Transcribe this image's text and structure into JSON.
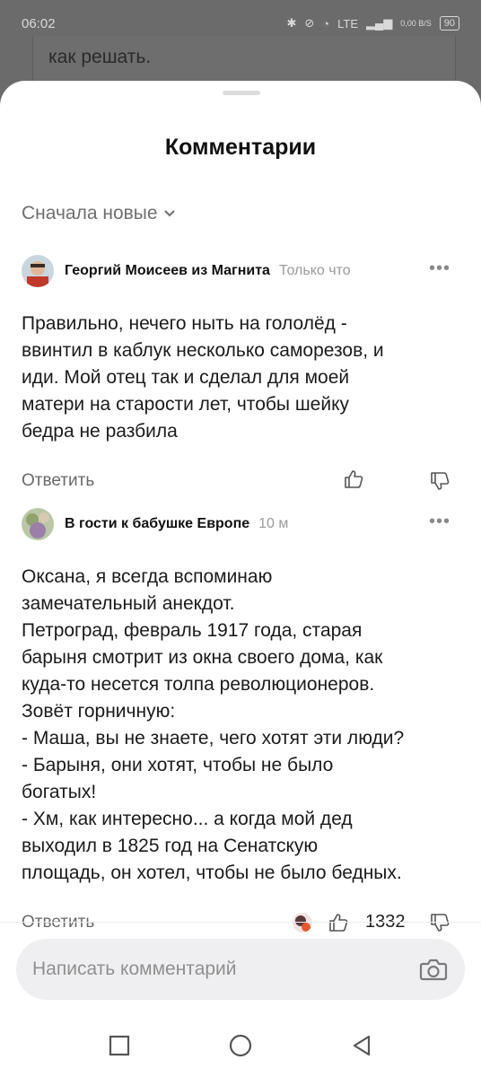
{
  "status_bar": {
    "time": "06:02",
    "network": "LTE",
    "speed": "0,00 B/S",
    "battery": "90"
  },
  "background": {
    "text": "как решать."
  },
  "sheet": {
    "title": "Комментарии",
    "sort_label": "Сначала новые"
  },
  "comments": [
    {
      "author": "Георгий Моисеев из Магнита",
      "time": "Только что",
      "text": "Правильно, нечего ныть на гололёд -\nввинтил в каблук несколько саморезов, и\nиди. Мой отец так и сделал для моей\nматери на старости лет, чтобы шейку\nбедра не разбила",
      "reply_label": "Ответить"
    },
    {
      "author": "В гости к бабушке Европе",
      "time": "10 м",
      "text": "Оксана, я всегда вспоминаю\nзамечательный анекдот.\nПетроград, февраль 1917 года, старая\nбарыня смотрит из окна своего дома, как\nкуда-то несется толпа революционеров.\nЗовёт горничную:\n- Маша, вы не знаете, чего хотят эти люди?\n- Барыня, они хотят, чтобы не было\nбогатых!\n- Хм, как интересно... а когда мой дед\nвыходил в 1825 год на Сенатскую\nплощадь, он хотел, чтобы не было бедных.",
      "reply_label": "Ответить",
      "like_count": "1332"
    }
  ],
  "composer": {
    "placeholder": "Написать комментарий"
  },
  "icons": {
    "more": "more-icon",
    "like": "thumbs-up-icon",
    "dislike": "thumbs-down-icon",
    "camera": "camera-icon",
    "nav": [
      "square-icon",
      "circle-icon",
      "back-triangle-icon"
    ]
  },
  "colors": {
    "text_primary": "#111111",
    "text_secondary": "#6f6f6f",
    "input_bg": "#efeff1"
  }
}
